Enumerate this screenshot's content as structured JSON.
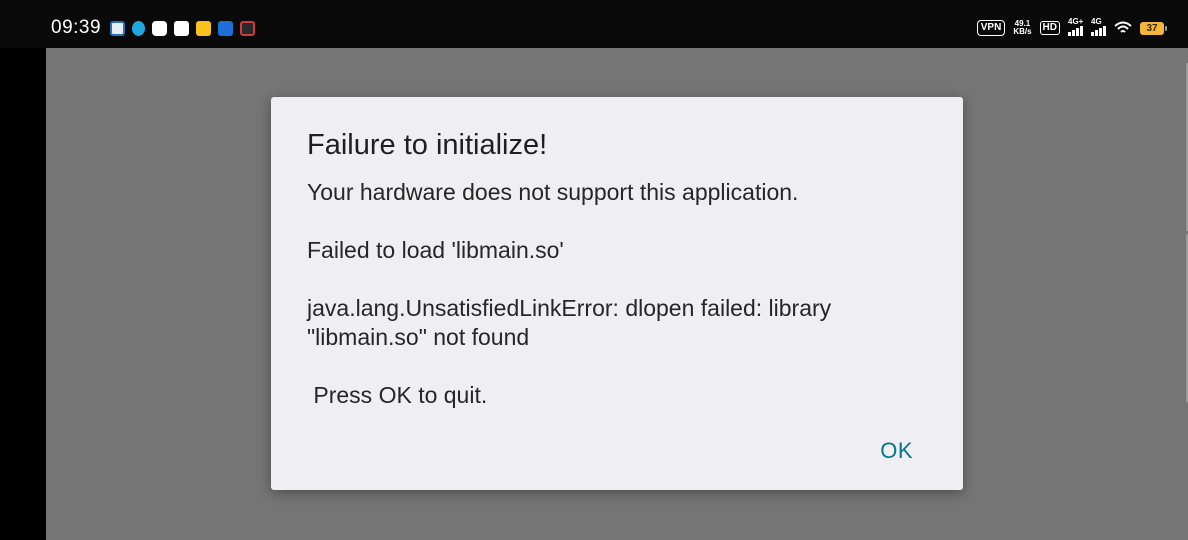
{
  "status_bar": {
    "time": "09:39",
    "notification_icons": [
      "app-icon",
      "droplet-icon",
      "chat-icon",
      "telegram-icon",
      "smile-icon",
      "calendar-icon",
      "news-icon"
    ],
    "vpn_label": "VPN",
    "net_speed_value": "49.1",
    "net_speed_unit": "KB/s",
    "hd_label": "HD",
    "signal1_label": "4G+",
    "signal2_label": "4G",
    "battery_level": "37",
    "battery_color": "#f4b53a"
  },
  "dialog": {
    "title": "Failure to initialize!",
    "line1": "Your hardware does not support this application.",
    "line2": "Failed to load 'libmain.so'",
    "line3": "java.lang.UnsatisfiedLinkError: dlopen failed: library \"libmain.so\" not found",
    "line4": " Press OK to quit.",
    "ok_label": "OK",
    "accent_color": "#00788a"
  }
}
